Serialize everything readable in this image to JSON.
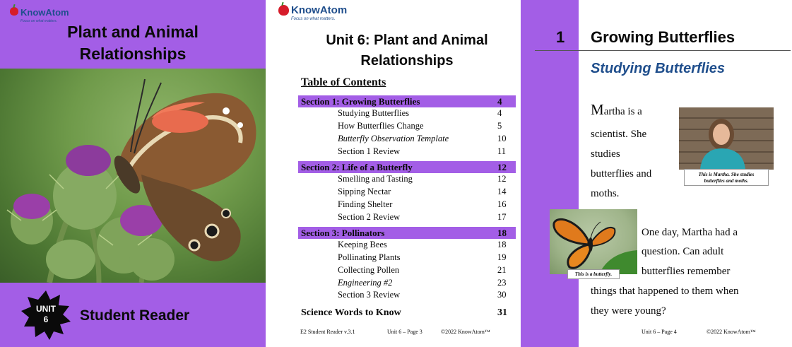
{
  "cover": {
    "logo_text": "KnowAtom",
    "logo_tagline": "Focus on what matters.",
    "title_line1": "Plant and Animal",
    "title_line2": "Relationships",
    "badge_line1": "UNIT",
    "badge_line2": "6",
    "footer_text": "Student Reader",
    "accent_color": "#a35ee6"
  },
  "toc": {
    "logo_text": "KnowAtom",
    "logo_tagline": "Focus on what matters.",
    "title_line1": "Unit 6: Plant and Animal",
    "title_line2": "Relationships",
    "heading": "Table of Contents",
    "rows": [
      {
        "label": "Section 1: Growing Butterflies",
        "page": "4"
      },
      {
        "label": "Studying Butterflies",
        "page": "4"
      },
      {
        "label": "How Butterflies Change",
        "page": "5"
      },
      {
        "label": "Butterfly Observation Template",
        "page": "10"
      },
      {
        "label": "Section 1 Review",
        "page": "11"
      },
      {
        "label": "Section 2: Life of a Butterfly",
        "page": "12"
      },
      {
        "label": "Smelling and Tasting",
        "page": "12"
      },
      {
        "label": "Sipping Nectar",
        "page": "14"
      },
      {
        "label": "Finding Shelter",
        "page": "16"
      },
      {
        "label": "Section 2 Review",
        "page": "17"
      },
      {
        "label": "Section 3: Pollinators",
        "page": "18"
      },
      {
        "label": "Keeping Bees",
        "page": "18"
      },
      {
        "label": "Pollinating Plants",
        "page": "19"
      },
      {
        "label": "Collecting Pollen",
        "page": "21"
      },
      {
        "label": "Engineering #2",
        "page": "23"
      },
      {
        "label": "Section 3 Review",
        "page": "30"
      },
      {
        "label": "Science Words to Know",
        "page": "31"
      }
    ],
    "footer_left": "E2 Student Reader v.3.1",
    "footer_mid": "Unit 6 – Page 3",
    "footer_right": "©2022 KnowAtom™"
  },
  "page4": {
    "section_number": "1",
    "section_title": "Growing Butterflies",
    "subheading": "Studying Butterflies",
    "para1_dropcap": "M",
    "para1_line1": "artha is a",
    "para1_line2": "scientist. She",
    "para1_line3": "studies",
    "para1_line4": "butterflies and",
    "para1_line5": "moths.",
    "photo1_caption_line1": "This is Martha. She studies",
    "photo1_caption_line2": "butterflies and moths.",
    "para2_line1": "One day, Martha had a",
    "para2_line2": "question. Can adult",
    "para2_line3": "butterflies remember",
    "para2_line4": "things that happened to them when",
    "para2_line5": "they were young?",
    "photo2_caption": "This is a butterfly.",
    "footer_mid": "Unit 6 – Page 4",
    "footer_right": "©2022 KnowAtom™"
  }
}
